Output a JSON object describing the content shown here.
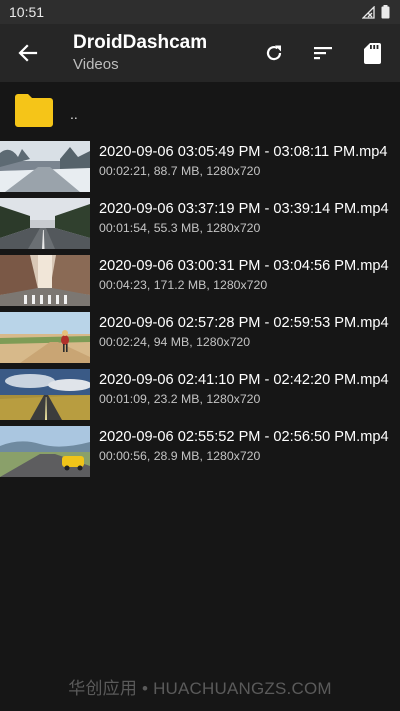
{
  "status_bar": {
    "time": "10:51"
  },
  "app_bar": {
    "title": "DroidDashcam",
    "subtitle": "Videos"
  },
  "parent_folder": {
    "label": "..",
    "icon": "folder-icon",
    "color": "#f5c518"
  },
  "files": [
    {
      "name": "2020-09-06 03:05:49 PM - 03:08:11 PM.mp4",
      "meta": "00:02:21, 88.7 MB, 1280x720",
      "thumb": "snowy-road"
    },
    {
      "name": "2020-09-06 03:37:19 PM - 03:39:14 PM.mp4",
      "meta": "00:01:54, 55.3 MB, 1280x720",
      "thumb": "forest-road"
    },
    {
      "name": "2020-09-06 03:00:31 PM - 03:04:56 PM.mp4",
      "meta": "00:04:23, 171.2 MB, 1280x720",
      "thumb": "city-street"
    },
    {
      "name": "2020-09-06 02:57:28 PM - 02:59:53 PM.mp4",
      "meta": "00:02:24, 94 MB, 1280x720",
      "thumb": "desert-walker"
    },
    {
      "name": "2020-09-06 02:41:10 PM - 02:42:20 PM.mp4",
      "meta": "00:01:09, 23.2 MB, 1280x720",
      "thumb": "cloudy-highway"
    },
    {
      "name": "2020-09-06 02:55:52 PM - 02:56:50 PM.mp4",
      "meta": "00:00:56, 28.9 MB, 1280x720",
      "thumb": "yellow-car-road"
    }
  ],
  "watermark": "华创应用 • HUACHUANGZS.COM",
  "colors": {
    "background": "#161616",
    "app_bar": "#262626",
    "status_bar": "#2e2e2e",
    "folder": "#f5c518"
  }
}
